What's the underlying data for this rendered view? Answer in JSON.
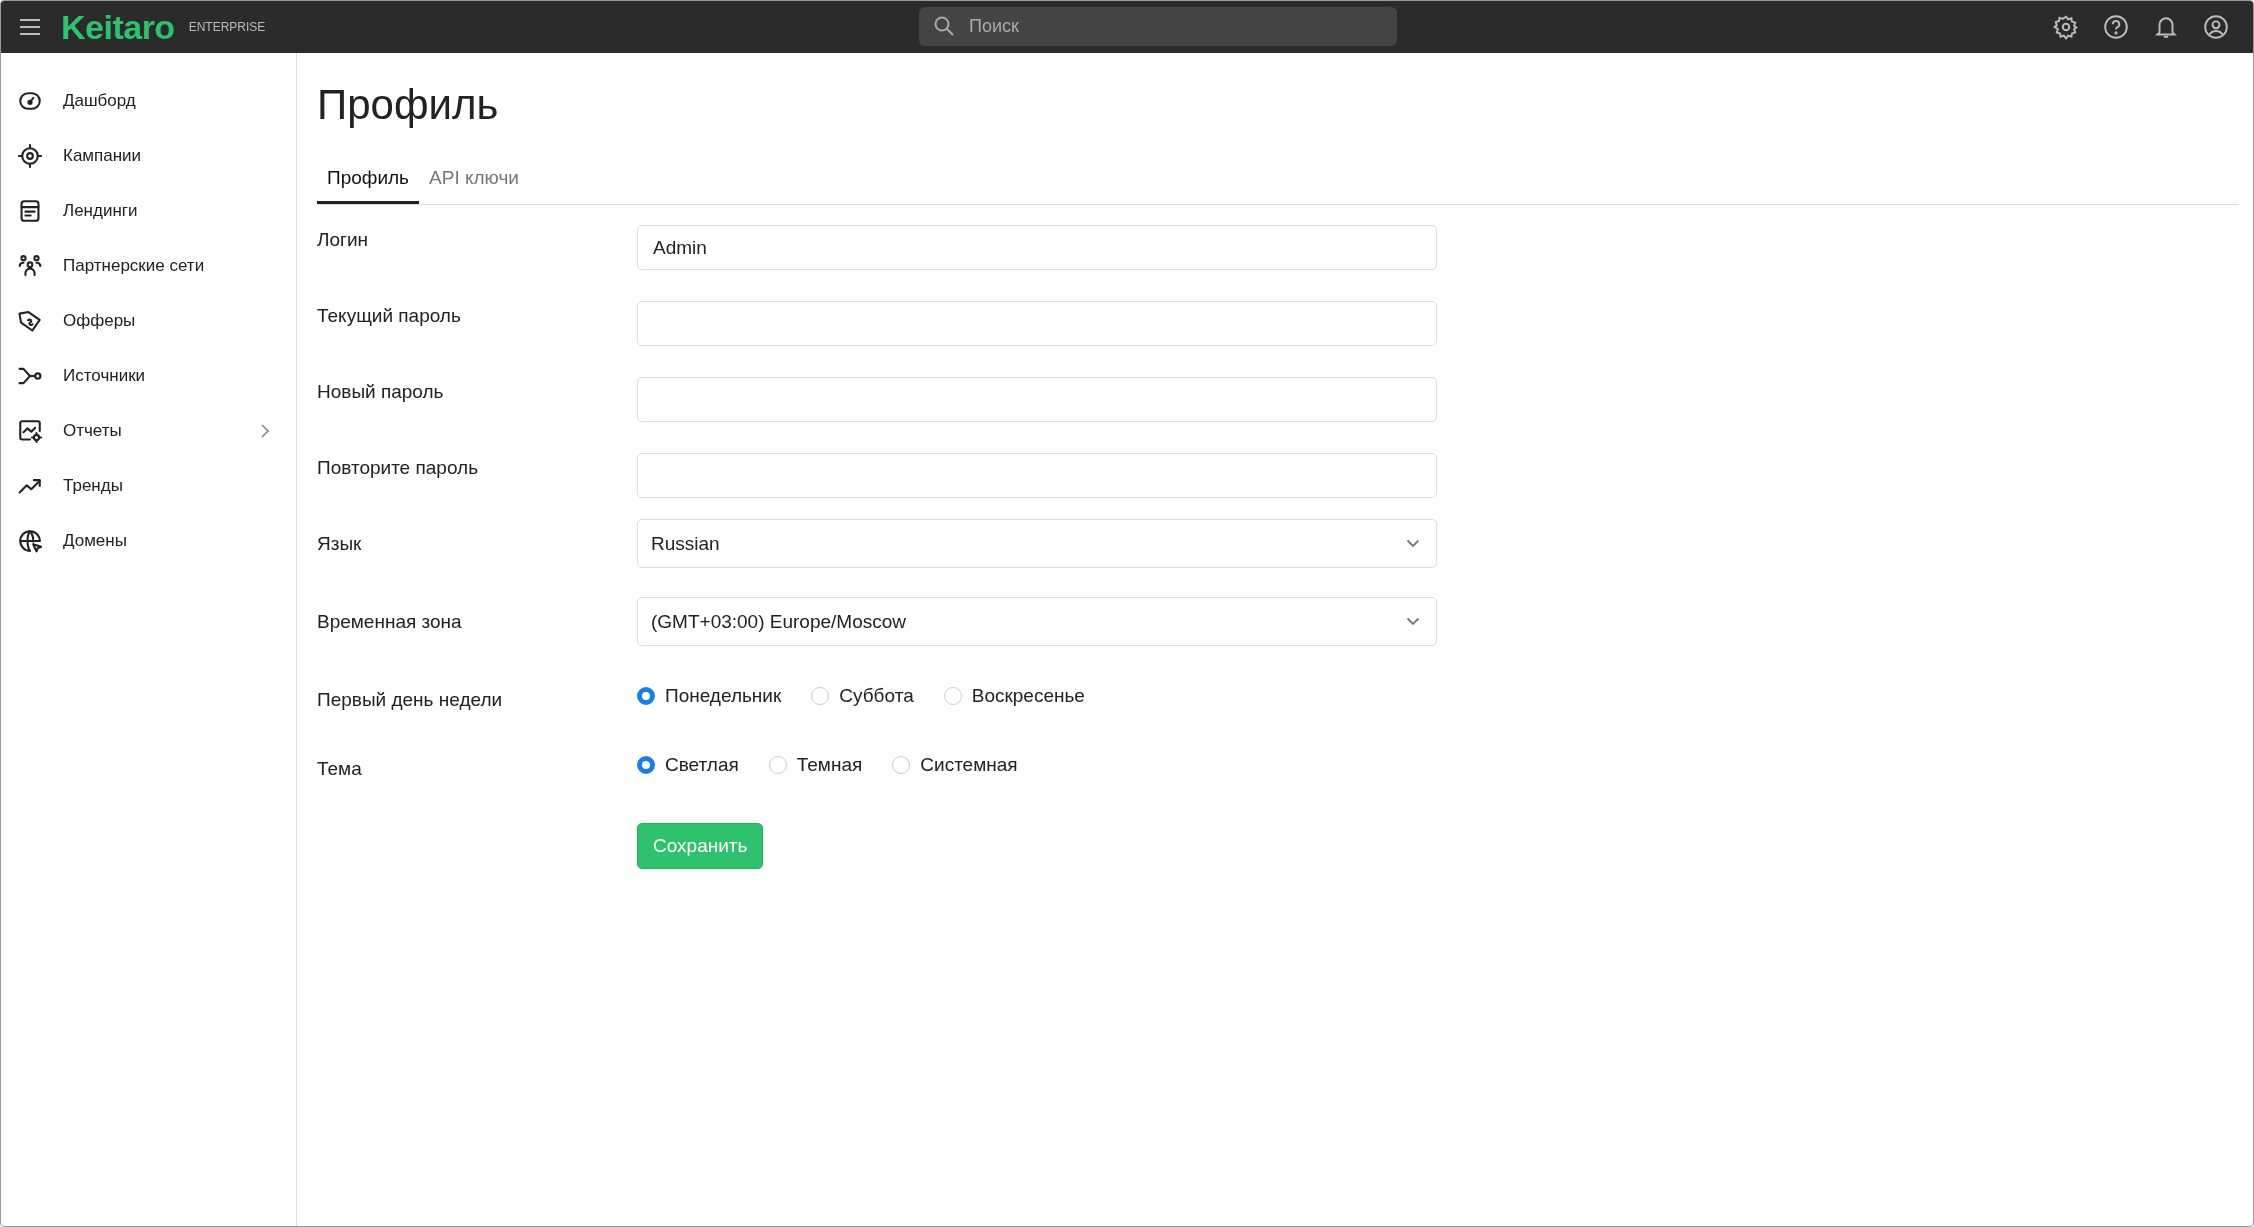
{
  "header": {
    "logo": "Keitaro",
    "edition": "ENTERPRISE",
    "search": {
      "placeholder": "Поиск"
    }
  },
  "sidebar": {
    "items": [
      {
        "label": "Дашборд",
        "expandable": false
      },
      {
        "label": "Кампании",
        "expandable": false
      },
      {
        "label": "Лендинги",
        "expandable": false
      },
      {
        "label": "Партнерские сети",
        "expandable": false
      },
      {
        "label": "Офферы",
        "expandable": false
      },
      {
        "label": "Источники",
        "expandable": false
      },
      {
        "label": "Отчеты",
        "expandable": true
      },
      {
        "label": "Тренды",
        "expandable": false
      },
      {
        "label": "Домены",
        "expandable": false
      }
    ]
  },
  "page": {
    "title": "Профиль",
    "tabs": [
      {
        "label": "Профиль",
        "selected": true
      },
      {
        "label": "API ключи",
        "selected": false
      }
    ],
    "form": [
      {
        "kind": "input",
        "label": "Логин",
        "value": "Admin"
      },
      {
        "kind": "input",
        "label": "Текущий пароль"
      },
      {
        "kind": "input",
        "label": "Новый пароль"
      },
      {
        "kind": "input",
        "label": "Повторите пароль"
      },
      {
        "kind": "select",
        "label": "Язык",
        "value": "Russian"
      },
      {
        "kind": "select",
        "label": "Временная зона",
        "value": "(GMT+03:00) Europe/Moscow"
      },
      {
        "kind": "radio",
        "label": "Первый день недели",
        "options": [
          {
            "label": "Понедельник",
            "selected": true
          },
          {
            "label": "Суббота",
            "selected": false
          },
          {
            "label": "Воскресенье",
            "selected": false
          }
        ]
      },
      {
        "kind": "radio",
        "label": "Тема",
        "options": [
          {
            "label": "Светлая",
            "selected": true
          },
          {
            "label": "Темная",
            "selected": false
          },
          {
            "label": "Системная",
            "selected": false
          }
        ]
      }
    ],
    "save_button": "Сохранить"
  }
}
